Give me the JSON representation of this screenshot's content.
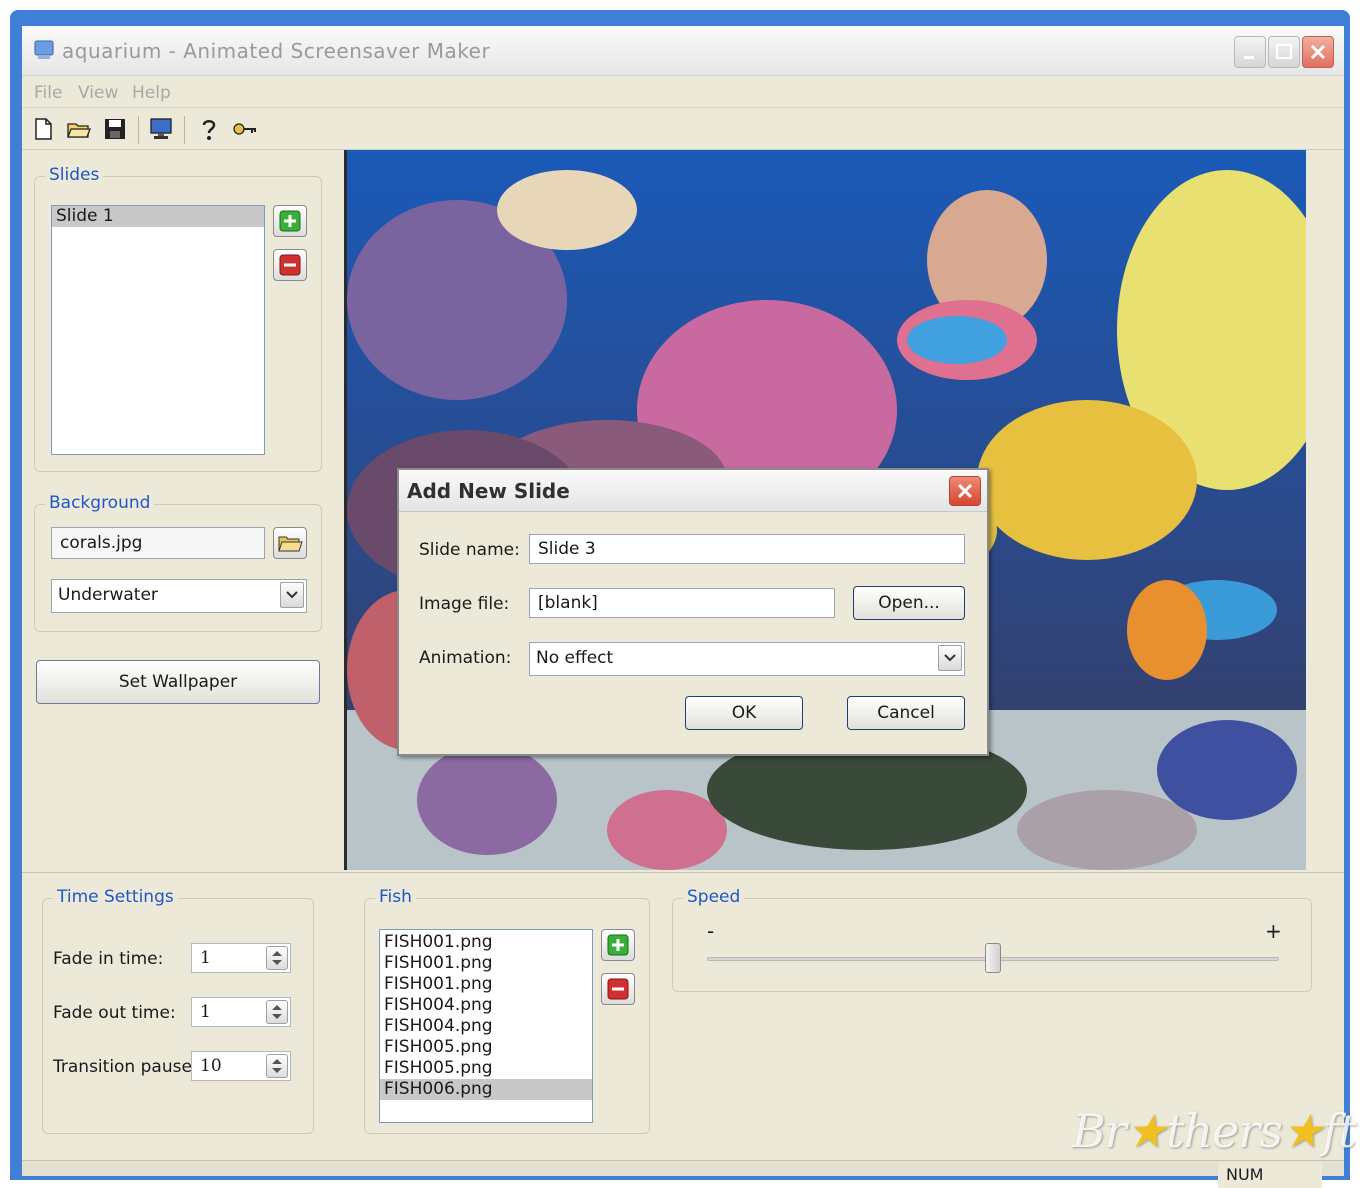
{
  "window": {
    "title": "aquarium - Animated Screensaver Maker"
  },
  "menu": {
    "file": "File",
    "view": "View",
    "help": "Help"
  },
  "toolbar": {
    "icons": [
      "new-file-icon",
      "open-folder-icon",
      "save-icon",
      "monitor-icon",
      "help-icon",
      "key-icon"
    ]
  },
  "slides": {
    "group_title": "Slides",
    "items": [
      {
        "label": "Slide 1",
        "selected": true
      }
    ]
  },
  "background": {
    "group_title": "Background",
    "file": "corals.jpg",
    "theme": "Underwater"
  },
  "set_wallpaper_label": "Set Wallpaper",
  "dialog": {
    "title": "Add New Slide",
    "slide_name_label": "Slide name:",
    "slide_name_value": "Slide 3",
    "image_file_label": "Image file:",
    "image_file_value": "[blank]",
    "open_label": "Open...",
    "animation_label": "Animation:",
    "animation_value": "No effect",
    "ok_label": "OK",
    "cancel_label": "Cancel"
  },
  "time_settings": {
    "group_title": "Time Settings",
    "fade_in_label": "Fade in time:",
    "fade_in_value": "1",
    "fade_out_label": "Fade out time:",
    "fade_out_value": "1",
    "transition_label": "Transition pause:",
    "transition_value": "10"
  },
  "fish": {
    "group_title": "Fish",
    "items": [
      {
        "label": "FISH001.png",
        "selected": false
      },
      {
        "label": "FISH001.png",
        "selected": false
      },
      {
        "label": "FISH001.png",
        "selected": false
      },
      {
        "label": "FISH004.png",
        "selected": false
      },
      {
        "label": "FISH004.png",
        "selected": false
      },
      {
        "label": "FISH005.png",
        "selected": false
      },
      {
        "label": "FISH005.png",
        "selected": false
      },
      {
        "label": "FISH006.png",
        "selected": true
      }
    ]
  },
  "speed": {
    "group_title": "Speed",
    "min_label": "-",
    "max_label": "+",
    "level": 0.5
  },
  "status": {
    "num": "NUM"
  },
  "watermark": "Brothersoft",
  "colors": {
    "group_title": "#1f57c8",
    "window_frame": "#3f7fd6",
    "panel": "#ece9d8",
    "add_green": "#2ea02e",
    "remove_red": "#c02020"
  }
}
